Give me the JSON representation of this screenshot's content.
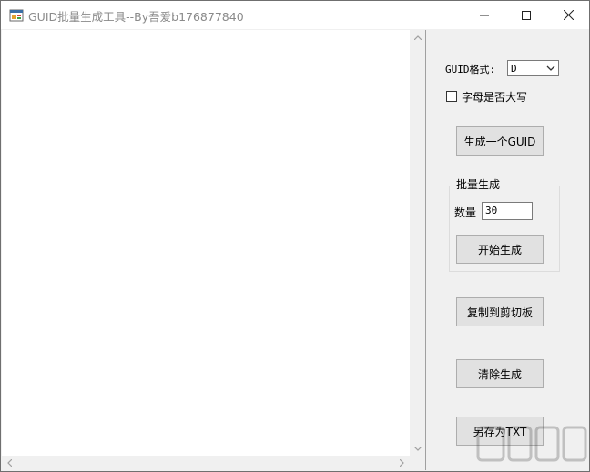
{
  "window": {
    "title": "GUID批量生成工具--By吾爱b176877840"
  },
  "output": {
    "value": ""
  },
  "format": {
    "label": "GUID格式:",
    "selected": "D"
  },
  "uppercase": {
    "label": "字母是否大写",
    "checked": false
  },
  "buttons": {
    "generate_one": "生成一个GUID",
    "start_batch": "开始生成",
    "copy": "复制到剪切板",
    "clear": "清除生成",
    "save_txt": "另存为TXT"
  },
  "batch": {
    "group_title": "批量生成",
    "count_label": "数量",
    "count_value": "30"
  },
  "icons": {
    "app": "app-window-icon",
    "minimize": "minimize-icon",
    "maximize": "maximize-icon",
    "close": "close-icon"
  }
}
